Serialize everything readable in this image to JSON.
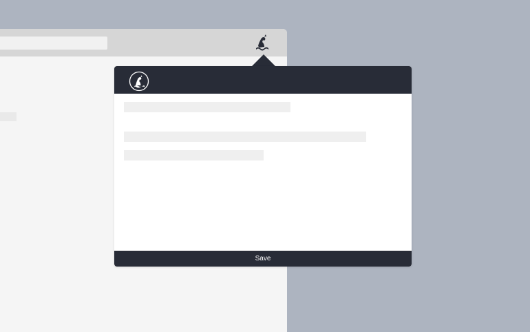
{
  "colors": {
    "desktop_background": "#adb4c0",
    "browser_toolbar": "#d6d6d6",
    "browser_page": "#f5f5f5",
    "popup_dark": "#282c37",
    "popup_body": "#ffffff",
    "placeholder": "#efefef"
  },
  "browser": {
    "toolbar": {
      "extension_icon": "mastodon-mascot-icon"
    }
  },
  "popup": {
    "header": {
      "logo_icon": "mastodon-mascot-badge-icon"
    },
    "save_label": "Save"
  }
}
